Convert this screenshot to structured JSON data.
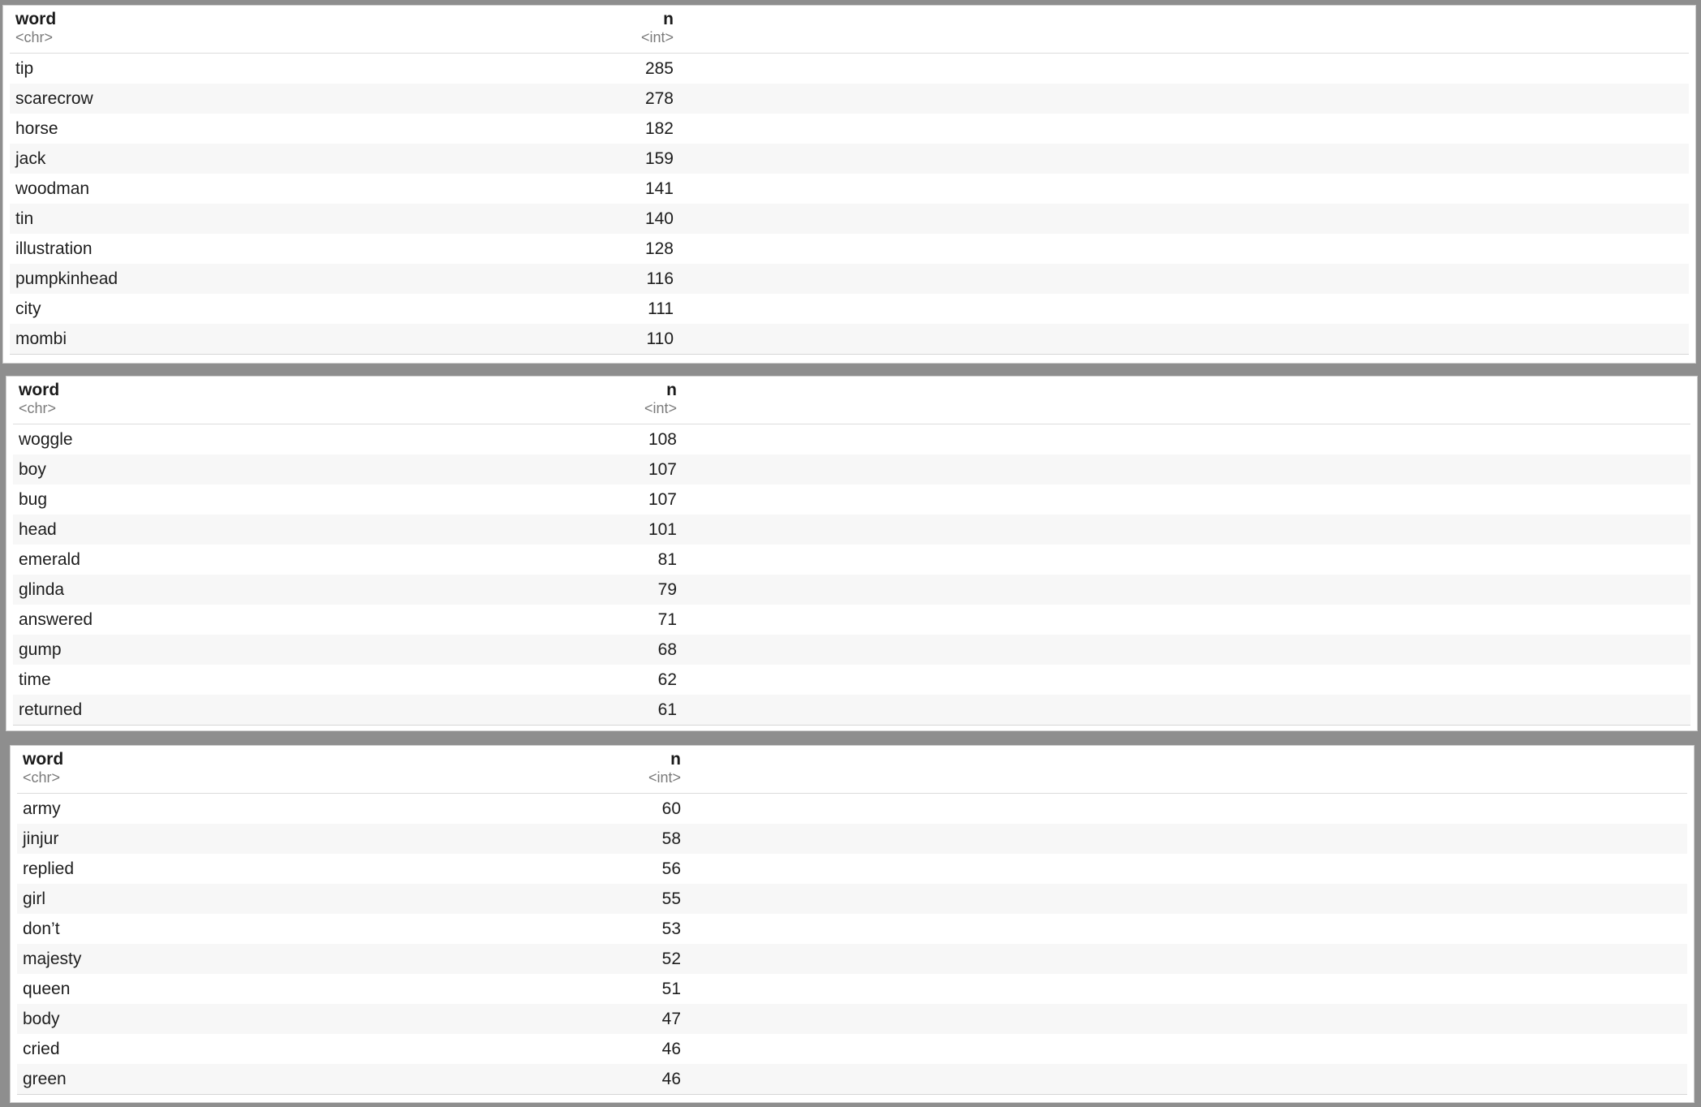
{
  "tables": [
    {
      "columns": [
        {
          "name": "word",
          "type": "<chr>"
        },
        {
          "name": "n",
          "type": "<int>"
        }
      ],
      "rows": [
        {
          "word": "tip",
          "n": "285"
        },
        {
          "word": "scarecrow",
          "n": "278"
        },
        {
          "word": "horse",
          "n": "182"
        },
        {
          "word": "jack",
          "n": "159"
        },
        {
          "word": "woodman",
          "n": "141"
        },
        {
          "word": "tin",
          "n": "140"
        },
        {
          "word": "illustration",
          "n": "128"
        },
        {
          "word": "pumpkinhead",
          "n": "116"
        },
        {
          "word": "city",
          "n": "111"
        },
        {
          "word": "mombi",
          "n": "110"
        }
      ]
    },
    {
      "columns": [
        {
          "name": "word",
          "type": "<chr>"
        },
        {
          "name": "n",
          "type": "<int>"
        }
      ],
      "rows": [
        {
          "word": "woggle",
          "n": "108"
        },
        {
          "word": "boy",
          "n": "107"
        },
        {
          "word": "bug",
          "n": "107"
        },
        {
          "word": "head",
          "n": "101"
        },
        {
          "word": "emerald",
          "n": "81"
        },
        {
          "word": "glinda",
          "n": "79"
        },
        {
          "word": "answered",
          "n": "71"
        },
        {
          "word": "gump",
          "n": "68"
        },
        {
          "word": "time",
          "n": "62"
        },
        {
          "word": "returned",
          "n": "61"
        }
      ]
    },
    {
      "columns": [
        {
          "name": "word",
          "type": "<chr>"
        },
        {
          "name": "n",
          "type": "<int>"
        }
      ],
      "rows": [
        {
          "word": "army",
          "n": "60"
        },
        {
          "word": "jinjur",
          "n": "58"
        },
        {
          "word": "replied",
          "n": "56"
        },
        {
          "word": "girl",
          "n": "55"
        },
        {
          "word": "don’t",
          "n": "53"
        },
        {
          "word": "majesty",
          "n": "52"
        },
        {
          "word": "queen",
          "n": "51"
        },
        {
          "word": "body",
          "n": "47"
        },
        {
          "word": "cried",
          "n": "46"
        },
        {
          "word": "green",
          "n": "46"
        }
      ]
    }
  ]
}
